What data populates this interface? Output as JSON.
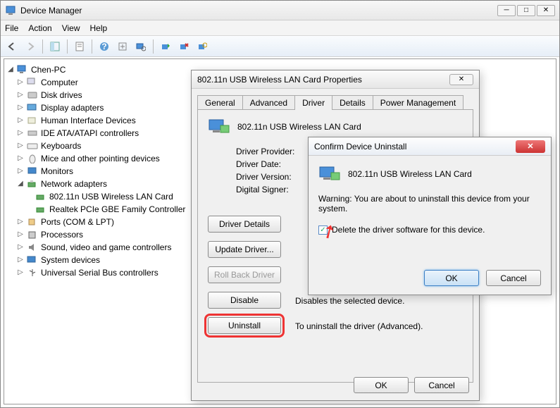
{
  "window": {
    "title": "Device Manager"
  },
  "menu": {
    "file": "File",
    "action": "Action",
    "view": "View",
    "help": "Help"
  },
  "tree": {
    "root": "Chen-PC",
    "items": [
      "Computer",
      "Disk drives",
      "Display adapters",
      "Human Interface Devices",
      "IDE ATA/ATAPI controllers",
      "Keyboards",
      "Mice and other pointing devices",
      "Monitors",
      "Network adapters",
      "Ports (COM & LPT)",
      "Processors",
      "Sound, video and game controllers",
      "System devices",
      "Universal Serial Bus controllers"
    ],
    "net_children": [
      "802.11n USB Wireless LAN Card",
      "Realtek PCIe GBE Family Controller"
    ]
  },
  "props": {
    "title": "802.11n USB Wireless LAN Card Properties",
    "tabs": [
      "General",
      "Advanced",
      "Driver",
      "Details",
      "Power Management"
    ],
    "device": "802.11n USB Wireless LAN Card",
    "rows": {
      "provider_k": "Driver Provider:",
      "date_k": "Driver Date:",
      "version_k": "Driver Version:",
      "signer_k": "Digital Signer:"
    },
    "buttons": {
      "details": "Driver Details",
      "update": "Update Driver...",
      "rollback": "Roll Back Driver",
      "disable": "Disable",
      "uninstall": "Uninstall"
    },
    "desc": {
      "disable": "Disables the selected device.",
      "uninstall": "To uninstall the driver (Advanced)."
    },
    "ok": "OK",
    "cancel": "Cancel"
  },
  "confirm": {
    "title": "Confirm Device Uninstall",
    "device": "802.11n USB Wireless LAN Card",
    "warning": "Warning: You are about to uninstall this device from your system.",
    "checkbox": "Delete the driver software for this device.",
    "ok": "OK",
    "cancel": "Cancel"
  }
}
